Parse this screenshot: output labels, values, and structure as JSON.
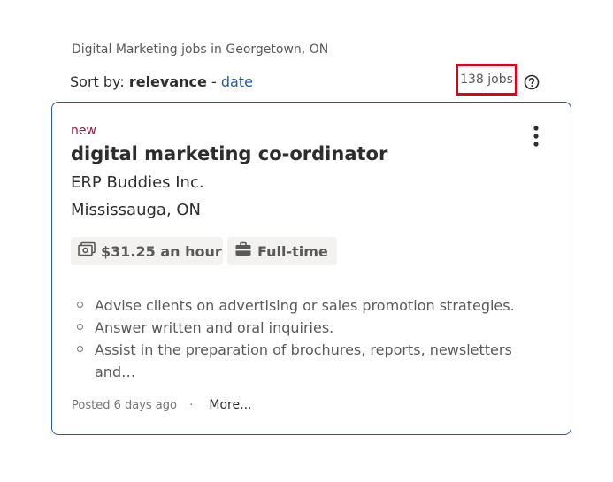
{
  "search": {
    "heading": "Digital Marketing jobs in Georgetown, ON"
  },
  "sort": {
    "prefix": "Sort by:",
    "active": "relevance",
    "separator": "-",
    "option_date": "date"
  },
  "results": {
    "count_label": "138 jobs",
    "help_icon": "question-circle-icon",
    "highlight_color": "#e0001b"
  },
  "job": {
    "badge": "new",
    "title": "digital marketing co-ordinator",
    "company": "ERP Buddies Inc.",
    "location": "Mississauga, ON",
    "salary": "$31.25 an hour",
    "salary_icon": "money-icon",
    "job_type": "Full-time",
    "job_type_icon": "briefcase-icon",
    "snippet": [
      "Advise clients on advertising or sales promotion strategies.",
      "Answer written and oral inquiries.",
      "Assist in the preparation of brochures, reports, newsletters and…"
    ],
    "posted": "Posted 6 days ago",
    "dot": "·",
    "more_link": "More...",
    "menu_icon": "more-vertical-icon"
  },
  "colors": {
    "link": "#2557a7",
    "badge": "#8c1c42",
    "card_border": "#2557a7",
    "chip_bg": "#f3f2f1"
  }
}
